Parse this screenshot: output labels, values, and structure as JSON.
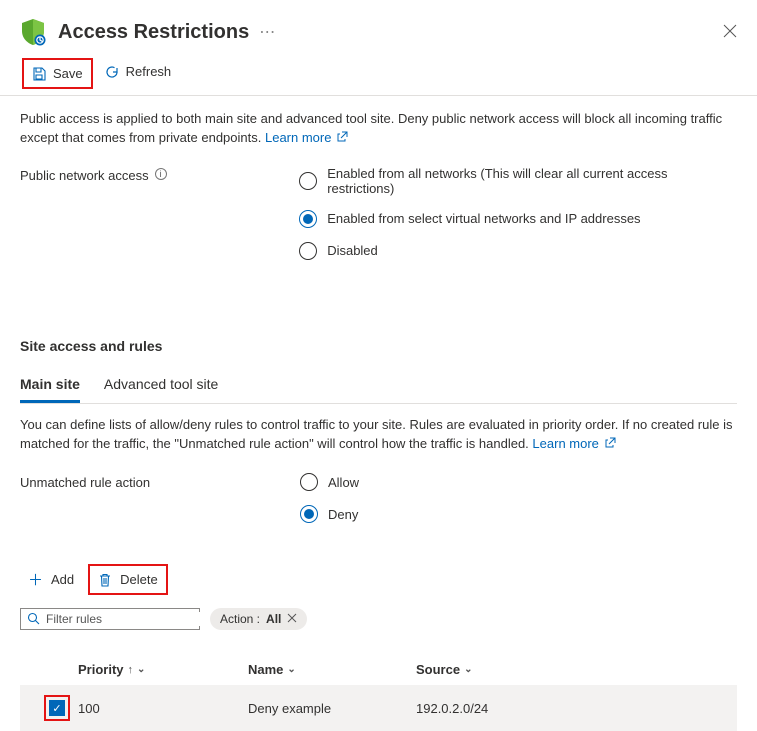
{
  "header": {
    "title": "Access Restrictions",
    "ellipsis": "⋯"
  },
  "toolbar": {
    "save_label": "Save",
    "refresh_label": "Refresh"
  },
  "description": {
    "text": "Public access is applied to both main site and advanced tool site. Deny public network access will block all incoming traffic except that comes from private endpoints.",
    "learn_more": "Learn more"
  },
  "public_access": {
    "label": "Public network access",
    "options": {
      "all": "Enabled from all networks (This will clear all current access restrictions)",
      "select": "Enabled from select virtual networks and IP addresses",
      "disabled": "Disabled"
    }
  },
  "section_title": "Site access and rules",
  "tabs": {
    "main": "Main site",
    "advanced": "Advanced tool site"
  },
  "rules_desc": {
    "text": "You can define lists of allow/deny rules to control traffic to your site. Rules are evaluated in priority order. If no created rule is matched for the traffic, the \"Unmatched rule action\" will control how the traffic is handled.",
    "learn_more": "Learn more"
  },
  "unmatched": {
    "label": "Unmatched rule action",
    "options": {
      "allow": "Allow",
      "deny": "Deny"
    }
  },
  "actions": {
    "add": "Add",
    "delete": "Delete"
  },
  "filter": {
    "placeholder": "Filter rules",
    "pill_label": "Action :",
    "pill_value": "All"
  },
  "table": {
    "headers": {
      "priority": "Priority",
      "name": "Name",
      "source": "Source"
    },
    "row": {
      "priority": "100",
      "name": "Deny example",
      "source": "192.0.2.0/24"
    }
  }
}
